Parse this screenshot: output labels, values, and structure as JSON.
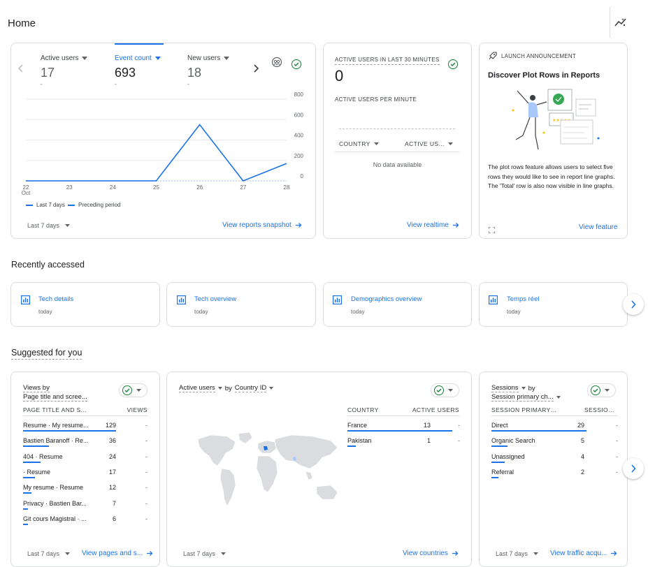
{
  "page": {
    "title": "Home"
  },
  "overview": {
    "metrics": [
      {
        "label": "Active users",
        "value": "17",
        "delta": "-"
      },
      {
        "label": "Event count",
        "value": "693",
        "delta": "-"
      },
      {
        "label": "New users",
        "value": "18",
        "delta": "-"
      }
    ],
    "legend": {
      "current": "Last 7 days",
      "previous": "Preceding period"
    },
    "date_range": "Last 7 days",
    "link": "View reports snapshot"
  },
  "chart_data": {
    "type": "line",
    "categories": [
      "22",
      "23",
      "24",
      "25",
      "26",
      "27",
      "28"
    ],
    "x_sublabel": "Oct",
    "series": [
      {
        "name": "Last 7 days",
        "values": [
          0,
          0,
          0,
          0,
          550,
          0,
          170
        ]
      },
      {
        "name": "Preceding period",
        "values": [
          0,
          0,
          0,
          0,
          0,
          0,
          0
        ]
      }
    ],
    "y_ticks": [
      "800",
      "600",
      "400",
      "200",
      "0"
    ],
    "ylim": [
      0,
      800
    ],
    "colors": {
      "current": "#1a73e8",
      "previous": "#1a73e8"
    }
  },
  "realtime": {
    "title": "ACTIVE USERS IN LAST 30 MINUTES",
    "value": "0",
    "per_minute_label": "ACTIVE USERS PER MINUTE",
    "col_country": "COUNTRY",
    "col_users": "ACTIVE US...",
    "empty": "No data available",
    "link": "View realtime"
  },
  "announcement": {
    "tag": "LAUNCH ANNOUNCEMENT",
    "title": "Discover Plot Rows in Reports",
    "body": "The plot rows feature allows users to select five rows they would like to see in report line graphs. The 'Total' row is also now visible in line graphs.",
    "link": "View feature"
  },
  "recent": {
    "title": "Recently accessed",
    "items": [
      {
        "label": "Tech details",
        "time": "today"
      },
      {
        "label": "Tech overview",
        "time": "today"
      },
      {
        "label": "Demographics overview",
        "time": "today"
      },
      {
        "label": "Temps réel",
        "time": "today"
      }
    ]
  },
  "suggested": {
    "title": "Suggested for you",
    "views": {
      "title": "Views by",
      "subtitle": "Page title and scree...",
      "col_name": "PAGE TITLE AND S...",
      "col_value": "VIEWS",
      "rows": [
        {
          "name": "Resume · My resume...",
          "value": "129",
          "dash": "-",
          "bar": 1.0
        },
        {
          "name": "Bastien Baranoff · Re...",
          "value": "36",
          "dash": "-",
          "bar": 0.28
        },
        {
          "name": "404 · Resume",
          "value": "24",
          "dash": "-",
          "bar": 0.19
        },
        {
          "name": "· Resume",
          "value": "17",
          "dash": "-",
          "bar": 0.13
        },
        {
          "name": "My resume · Resume",
          "value": "12",
          "dash": "-",
          "bar": 0.09
        },
        {
          "name": "Privacy · Bastien Bar...",
          "value": "7",
          "dash": "-",
          "bar": 0.05
        },
        {
          "name": "Git cours Magistral · ...",
          "value": "6",
          "dash": "-",
          "bar": 0.05
        }
      ],
      "date_range": "Last 7 days",
      "link": "View pages and s..."
    },
    "countries": {
      "metric": "Active users",
      "by": "by",
      "dimension": "Country ID",
      "col_name": "COUNTRY",
      "col_value": "ACTIVE USERS",
      "rows": [
        {
          "name": "France",
          "value": "13",
          "dash": "-",
          "bar": 1.0
        },
        {
          "name": "Pakistan",
          "value": "1",
          "dash": "-",
          "bar": 0.08
        }
      ],
      "date_range": "Last 7 days",
      "link": "View countries"
    },
    "sessions": {
      "metric": "Sessions",
      "by": "by",
      "dimension": "Session primary ch...",
      "col_name": "SESSION PRIMARY ...",
      "col_value": "SESSIONS",
      "rows": [
        {
          "name": "Direct",
          "value": "29",
          "dash": "-",
          "bar": 1.0
        },
        {
          "name": "Organic Search",
          "value": "5",
          "dash": "-",
          "bar": 0.17
        },
        {
          "name": "Unassigned",
          "value": "4",
          "dash": "-",
          "bar": 0.14
        },
        {
          "name": "Referral",
          "value": "2",
          "dash": "-",
          "bar": 0.07
        }
      ],
      "date_range": "Last 7 days",
      "link": "View traffic acqu..."
    }
  },
  "icons": {
    "insights": "insights-icon",
    "check": "check-circle-icon",
    "compare": "compare-icon",
    "rocket": "rocket-icon",
    "expand": "expand-icon",
    "report": "report-icon",
    "arrow": "arrow-forward-icon",
    "chevron": "chevron-right-icon"
  }
}
